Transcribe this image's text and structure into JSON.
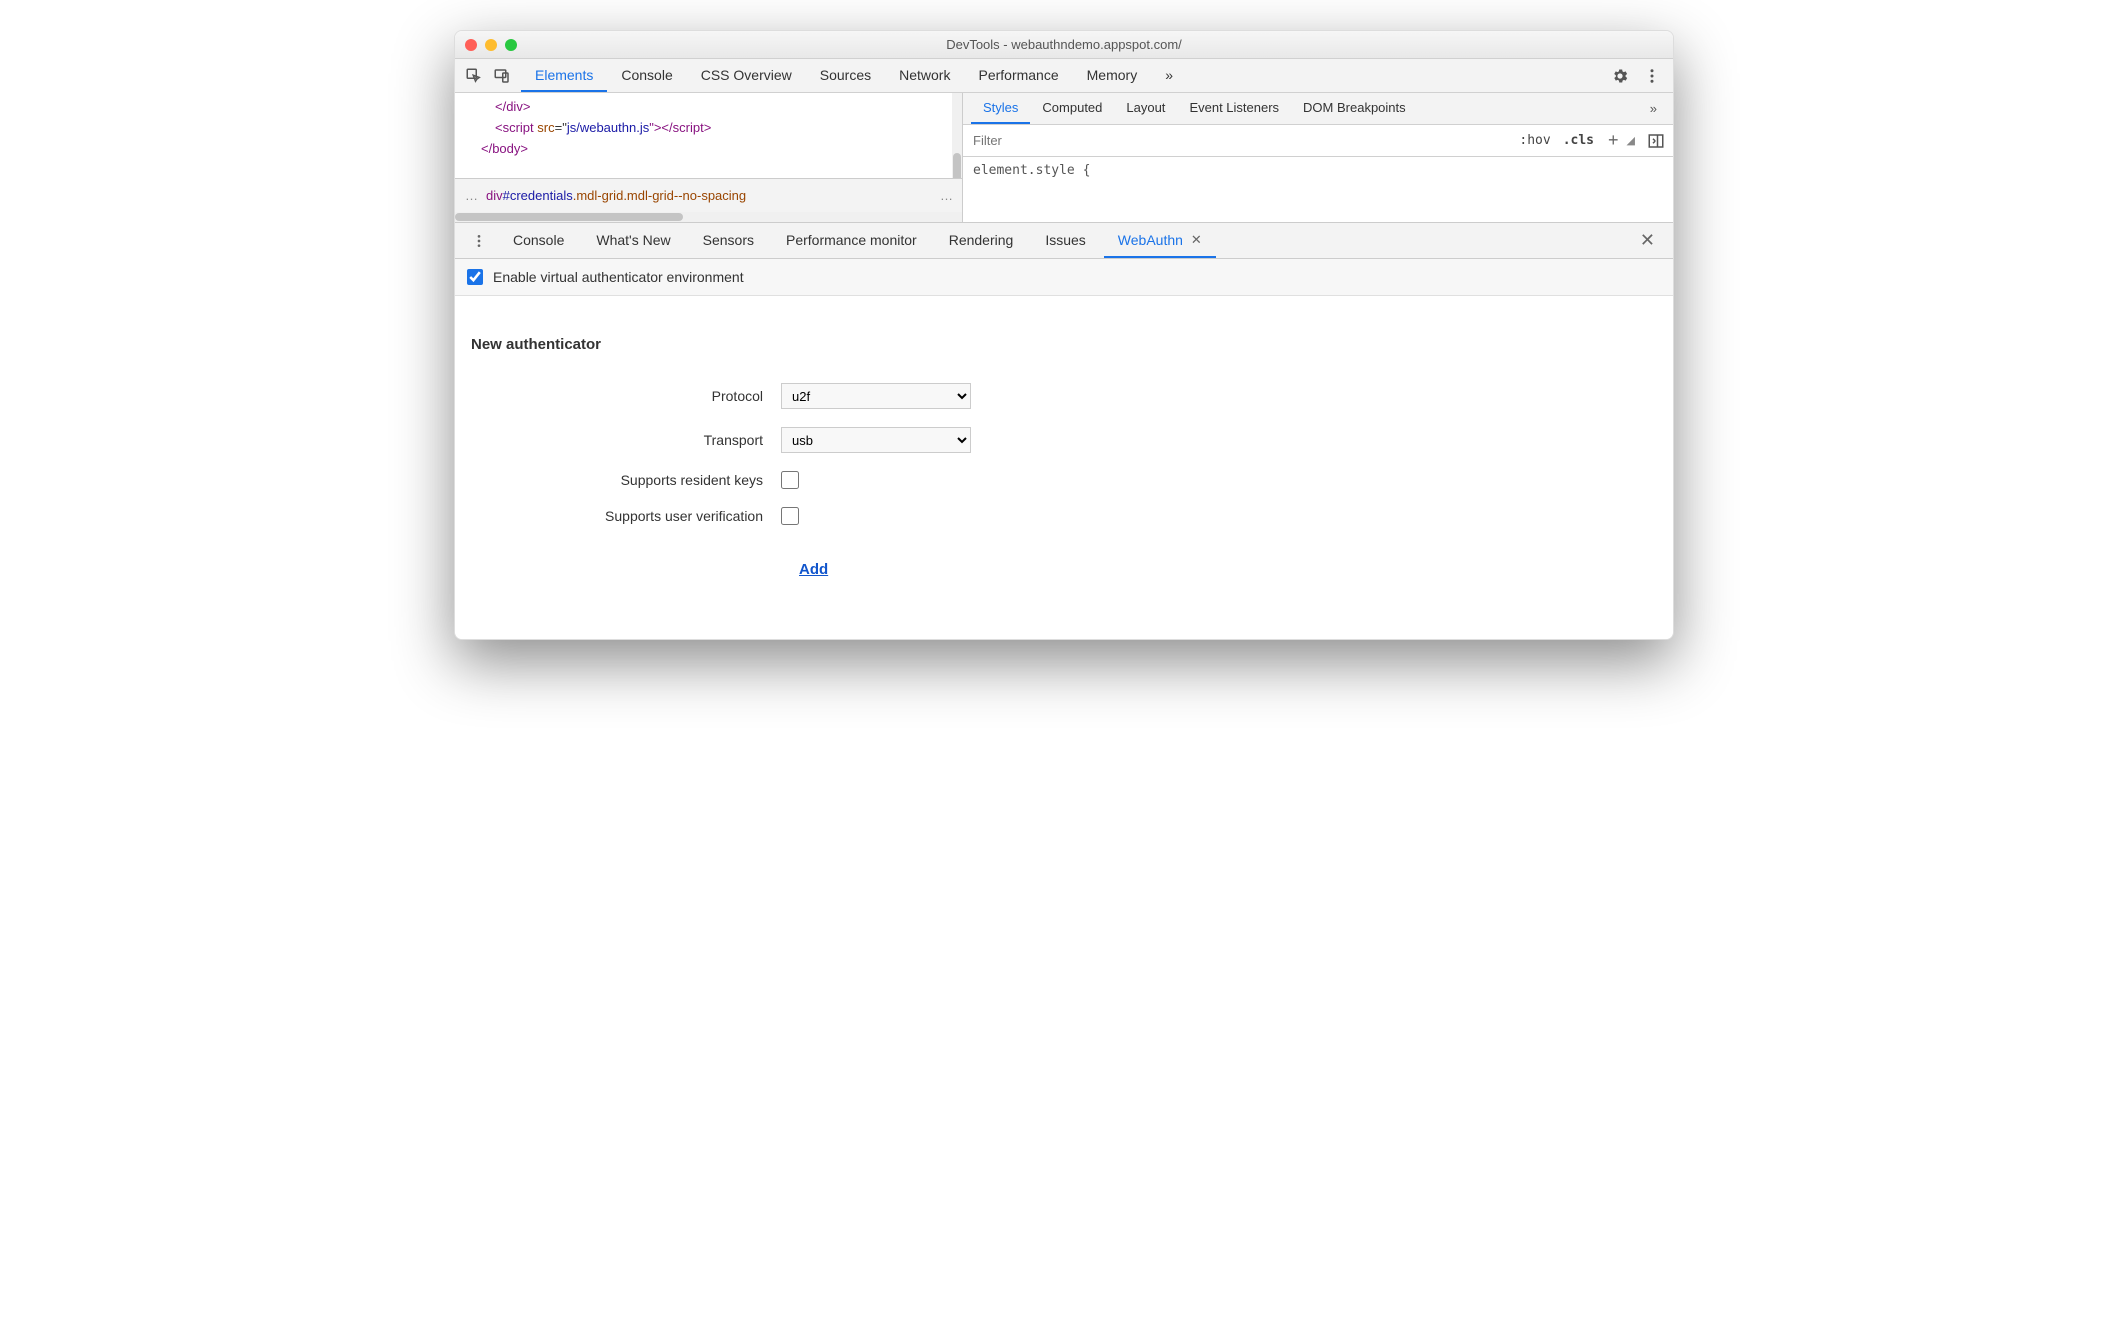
{
  "window": {
    "title": "DevTools - webauthndemo.appspot.com/"
  },
  "mainTabs": {
    "items": [
      "Elements",
      "Console",
      "CSS Overview",
      "Sources",
      "Network",
      "Performance",
      "Memory"
    ],
    "active": "Elements",
    "overflow": "»"
  },
  "code": {
    "line1_close_div": "</div>",
    "line2_open": "<script ",
    "line2_attr": "src",
    "line2_eq": "=\"",
    "line2_val": "js/webauthn.js",
    "line2_close": "\"></script>",
    "line3": "</body>"
  },
  "breadcrumb": {
    "left_dots": "…",
    "tag": "div",
    "hash": "#credentials",
    "cls1": ".mdl-grid",
    "cls2": ".mdl-grid--no-spacing",
    "right_dots": "…"
  },
  "styleTabs": {
    "items": [
      "Styles",
      "Computed",
      "Layout",
      "Event Listeners",
      "DOM Breakpoints"
    ],
    "active": "Styles",
    "overflow": "»"
  },
  "filter": {
    "placeholder": "Filter",
    "hov": ":hov",
    "cls": ".cls"
  },
  "styleContent": "element.style {",
  "drawerTabs": {
    "items": [
      "Console",
      "What's New",
      "Sensors",
      "Performance monitor",
      "Rendering",
      "Issues",
      "WebAuthn"
    ],
    "active": "WebAuthn"
  },
  "enable": {
    "label": "Enable virtual authenticator environment",
    "checked": true
  },
  "form": {
    "heading": "New authenticator",
    "protocol": {
      "label": "Protocol",
      "value": "u2f"
    },
    "transport": {
      "label": "Transport",
      "value": "usb"
    },
    "resident": {
      "label": "Supports resident keys"
    },
    "userver": {
      "label": "Supports user verification"
    },
    "add": "Add"
  }
}
